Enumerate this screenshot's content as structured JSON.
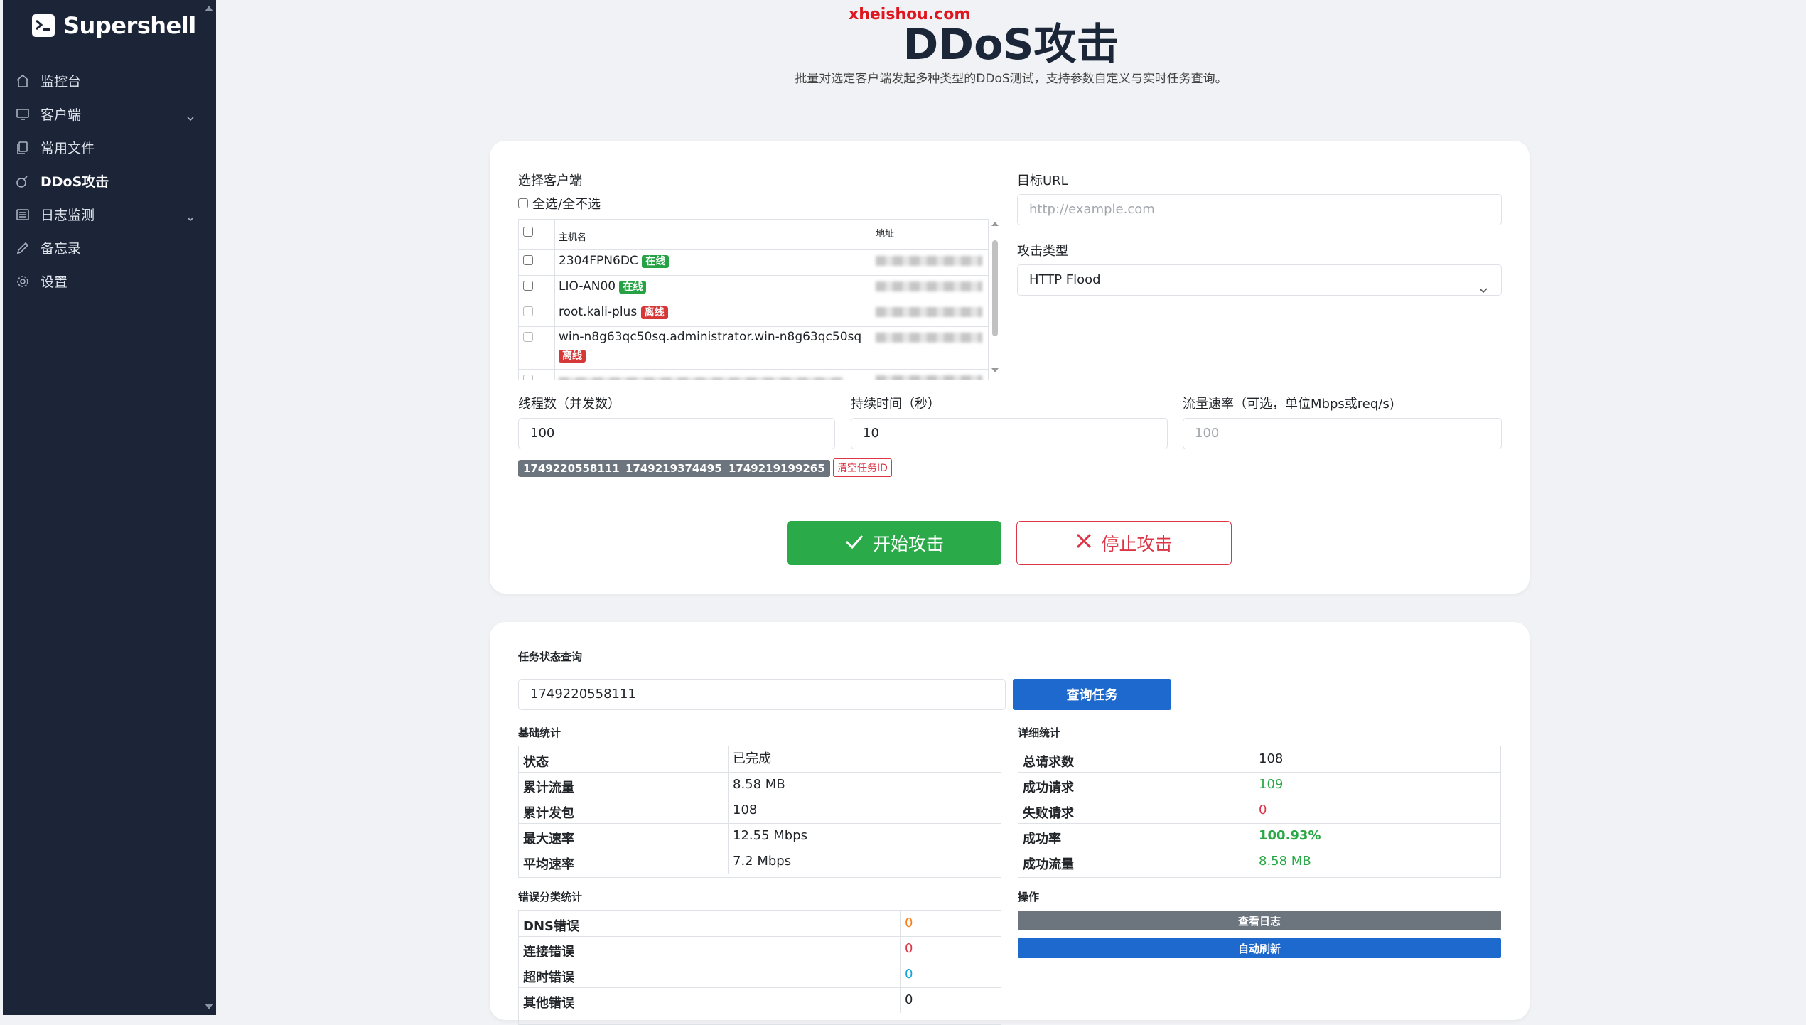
{
  "app": {
    "name": "Supershell",
    "watermark": "xheishou.com"
  },
  "sidebar": {
    "items": [
      {
        "label": "监控台",
        "icon": "home-icon"
      },
      {
        "label": "客户端",
        "icon": "monitor-icon",
        "has_children": true
      },
      {
        "label": "常用文件",
        "icon": "files-icon"
      },
      {
        "label": "DDoS攻击",
        "icon": "bomb-icon",
        "active": true
      },
      {
        "label": "日志监测",
        "icon": "list-icon",
        "has_children": true
      },
      {
        "label": "备忘录",
        "icon": "pencil-icon"
      },
      {
        "label": "设置",
        "icon": "gear-icon"
      }
    ]
  },
  "header": {
    "title": "DDoS攻击",
    "subtitle": "批量对选定客户端发起多种类型的DDoS测试，支持参数自定义与实时任务查询。"
  },
  "attack_form": {
    "client_label": "选择客户端",
    "select_all_label": "全选/全不选",
    "table_headers": {
      "host": "主机名",
      "addr": "地址"
    },
    "clients": [
      {
        "host": "2304FPN6DC",
        "status": "在线",
        "online": true
      },
      {
        "host": "LIO-AN00",
        "status": "在线",
        "online": true
      },
      {
        "host": "root.kali-plus",
        "status": "离线",
        "online": false
      },
      {
        "host": "win-n8g63qc50sq.administrator.win-n8g63qc50sq",
        "status": "离线",
        "online": false
      }
    ],
    "target_url_label": "目标URL",
    "target_url_placeholder": "http://example.com",
    "attack_type_label": "攻击类型",
    "attack_type_value": "HTTP Flood",
    "threads_label": "线程数（并发数）",
    "threads_value": "100",
    "duration_label": "持续时间（秒）",
    "duration_value": "10",
    "rate_label": "流量速率（可选，单位Mbps或req/s)",
    "rate_placeholder": "100",
    "task_ids": [
      "1749220558111",
      "1749219374495",
      "1749219199265"
    ],
    "clear_label": "清空任务ID",
    "start_label": "开始攻击",
    "stop_label": "停止攻击"
  },
  "task_query": {
    "title": "任务状态查询",
    "input_value": "1749220558111",
    "query_label": "查询任务",
    "basic_title": "基础统计",
    "basic": [
      {
        "k": "状态",
        "v": "已完成"
      },
      {
        "k": "累计流量",
        "v": "8.58 MB"
      },
      {
        "k": "累计发包",
        "v": "108"
      },
      {
        "k": "最大速率",
        "v": "12.55 Mbps"
      },
      {
        "k": "平均速率",
        "v": "7.2 Mbps"
      }
    ],
    "detail_title": "详细统计",
    "detail": [
      {
        "k": "总请求数",
        "v": "108"
      },
      {
        "k": "成功请求",
        "v": "109"
      },
      {
        "k": "失败请求",
        "v": "0"
      },
      {
        "k": "成功率",
        "v": "100.93%"
      },
      {
        "k": "成功流量",
        "v": "8.58 MB"
      }
    ],
    "error_title": "错误分类统计",
    "errors": [
      {
        "k": "DNS错误",
        "v": "0"
      },
      {
        "k": "连接错误",
        "v": "0"
      },
      {
        "k": "超时错误",
        "v": "0"
      },
      {
        "k": "其他错误",
        "v": "0"
      }
    ],
    "ops_title": "操作",
    "view_log_label": "查看日志",
    "auto_refresh_label": "自动刷新"
  },
  "colors": {
    "sidebar_bg": "#1c2537",
    "success": "#2aaa48",
    "danger": "#dc3545",
    "primary": "#1d69cd"
  }
}
